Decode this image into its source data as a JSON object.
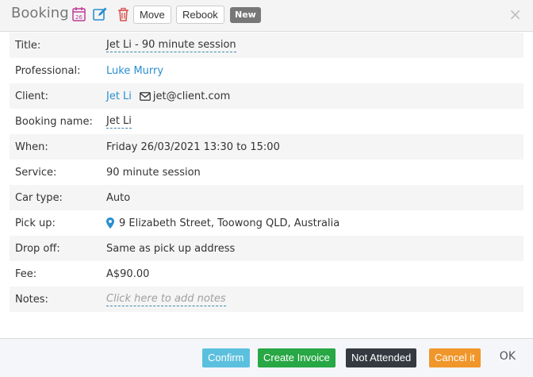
{
  "header": {
    "title": "Booking",
    "move_label": "Move",
    "rebook_label": "Rebook",
    "new_badge": "New",
    "close_glyph": "×",
    "calendar_icon_text": "26"
  },
  "fields": {
    "title": {
      "label": "Title:",
      "value": "Jet Li - 90 minute session"
    },
    "professional": {
      "label": "Professional:",
      "value": "Luke Murry"
    },
    "client": {
      "label": "Client:",
      "value": "Jet Li",
      "email": "jet@client.com"
    },
    "booking_name": {
      "label": "Booking name:",
      "value": "Jet Li"
    },
    "when": {
      "label": "When:",
      "value": "Friday 26/03/2021 13:30 to 15:00"
    },
    "service": {
      "label": "Service:",
      "value": "90 minute session"
    },
    "car_type": {
      "label": "Car type:",
      "value": "Auto"
    },
    "pick_up": {
      "label": "Pick up:",
      "value": "9 Elizabeth Street, Toowong QLD, Australia"
    },
    "drop_off": {
      "label": "Drop off:",
      "value": "Same as pick up address"
    },
    "fee": {
      "label": "Fee:",
      "value": "A$90.00"
    },
    "notes": {
      "label": "Notes:",
      "placeholder": "Click here to add notes"
    }
  },
  "footer": {
    "confirm_label": "Confirm",
    "create_invoice_label": "Create Invoice",
    "not_attended_label": "Not Attended",
    "cancel_label": "Cancel it",
    "ok_label": "OK"
  },
  "colors": {
    "confirm": "#5bc0de",
    "create_invoice": "#28a745",
    "not_attended": "#343a40",
    "cancel": "#f0962a",
    "link": "#2a8fd0",
    "calendar_icon": "#c0399a",
    "edit_icon": "#2a8fd0",
    "trash_icon": "#d9534f"
  },
  "icons": [
    "calendar-icon",
    "edit-icon",
    "trash-icon",
    "close-icon",
    "mail-icon",
    "map-pin-icon"
  ]
}
